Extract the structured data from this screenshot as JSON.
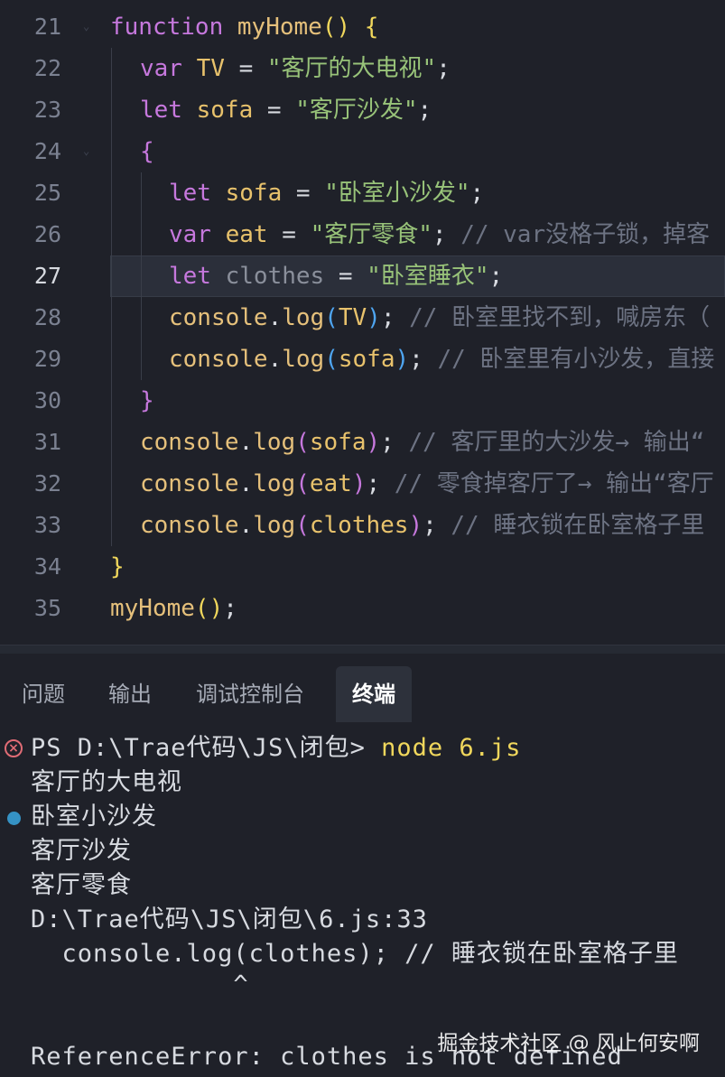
{
  "editor": {
    "lines": [
      {
        "num": "21",
        "tokens": [
          [
            "kw",
            "function"
          ],
          [
            "punc",
            " "
          ],
          [
            "fn",
            "myHome"
          ],
          [
            "ph",
            "()"
          ],
          [
            "punc",
            " "
          ],
          [
            "ph",
            "{"
          ]
        ]
      },
      {
        "num": "22",
        "tokens": [
          [
            "kw",
            "var"
          ],
          [
            "punc",
            " "
          ],
          [
            "var",
            "TV"
          ],
          [
            "punc",
            " = "
          ],
          [
            "str",
            "\"客厅的大电视\""
          ],
          [
            "punc",
            ";"
          ]
        ]
      },
      {
        "num": "23",
        "tokens": [
          [
            "kw",
            "let"
          ],
          [
            "punc",
            " "
          ],
          [
            "var",
            "sofa"
          ],
          [
            "punc",
            " = "
          ],
          [
            "str",
            "\"客厅沙发\""
          ],
          [
            "punc",
            ";"
          ]
        ]
      },
      {
        "num": "24",
        "tokens": [
          [
            "pp",
            "{"
          ]
        ]
      },
      {
        "num": "25",
        "tokens": [
          [
            "kw",
            "let"
          ],
          [
            "punc",
            " "
          ],
          [
            "var",
            "sofa"
          ],
          [
            "punc",
            " = "
          ],
          [
            "str",
            "\"卧室小沙发\""
          ],
          [
            "punc",
            ";"
          ]
        ]
      },
      {
        "num": "26",
        "tokens": [
          [
            "kw",
            "var"
          ],
          [
            "punc",
            " "
          ],
          [
            "var",
            "eat"
          ],
          [
            "punc",
            " = "
          ],
          [
            "str",
            "\"客厅零食\""
          ],
          [
            "punc",
            "; "
          ],
          [
            "cmt",
            "// var没格子锁，掉客"
          ]
        ]
      },
      {
        "num": "27",
        "tokens": [
          [
            "kw",
            "let"
          ],
          [
            "punc",
            " "
          ],
          [
            "grey",
            "clothes"
          ],
          [
            "punc",
            " = "
          ],
          [
            "str",
            "\"卧室睡衣\""
          ],
          [
            "punc",
            ";"
          ]
        ]
      },
      {
        "num": "28",
        "tokens": [
          [
            "fnn",
            "console"
          ],
          [
            "punc",
            "."
          ],
          [
            "fnn",
            "log"
          ],
          [
            "pb",
            "("
          ],
          [
            "var",
            "TV"
          ],
          [
            "pb",
            ")"
          ],
          [
            "punc",
            "; "
          ],
          [
            "cmt",
            "// 卧室里找不到，喊房东（"
          ]
        ]
      },
      {
        "num": "29",
        "tokens": [
          [
            "fnn",
            "console"
          ],
          [
            "punc",
            "."
          ],
          [
            "fnn",
            "log"
          ],
          [
            "pb",
            "("
          ],
          [
            "var",
            "sofa"
          ],
          [
            "pb",
            ")"
          ],
          [
            "punc",
            "; "
          ],
          [
            "cmt",
            "// 卧室里有小沙发，直接"
          ]
        ]
      },
      {
        "num": "30",
        "tokens": [
          [
            "pp",
            "}"
          ]
        ]
      },
      {
        "num": "31",
        "tokens": [
          [
            "fnn",
            "console"
          ],
          [
            "punc",
            "."
          ],
          [
            "fnn",
            "log"
          ],
          [
            "pp",
            "("
          ],
          [
            "var",
            "sofa"
          ],
          [
            "pp",
            ")"
          ],
          [
            "punc",
            "; "
          ],
          [
            "cmt",
            "// 客厅里的大沙发→ 输出“"
          ]
        ]
      },
      {
        "num": "32",
        "tokens": [
          [
            "fnn",
            "console"
          ],
          [
            "punc",
            "."
          ],
          [
            "fnn",
            "log"
          ],
          [
            "pp",
            "("
          ],
          [
            "var",
            "eat"
          ],
          [
            "pp",
            ")"
          ],
          [
            "punc",
            "; "
          ],
          [
            "cmt",
            "// 零食掉客厅了→ 输出“客厅"
          ]
        ]
      },
      {
        "num": "33",
        "tokens": [
          [
            "fnn",
            "console"
          ],
          [
            "punc",
            "."
          ],
          [
            "fnn",
            "log"
          ],
          [
            "pp",
            "("
          ],
          [
            "var",
            "clothes"
          ],
          [
            "pp",
            ")"
          ],
          [
            "punc",
            "; "
          ],
          [
            "cmt",
            "// 睡衣锁在卧室格子里"
          ]
        ]
      },
      {
        "num": "34",
        "tokens": [
          [
            "ph",
            "}"
          ]
        ]
      },
      {
        "num": "35",
        "tokens": [
          [
            "fn",
            "myHome"
          ],
          [
            "ph",
            "()"
          ],
          [
            "punc",
            ";"
          ]
        ]
      }
    ]
  },
  "panel": {
    "tabs": [
      "问题",
      "输出",
      "调试控制台",
      "终端"
    ],
    "active_tab": "终端"
  },
  "terminal": {
    "prompt": "PS D:\\Trae代码\\JS\\闭包> ",
    "command": "node 6.js",
    "out1": "客厅的大电视",
    "out2": "卧室小沙发",
    "out3": "客厅沙发",
    "out4": "客厅零食",
    "trace_path": "D:\\Trae代码\\JS\\闭包\\6.js:33",
    "trace_code": "  console.log(clothes); // 睡衣锁在卧室格子里",
    "trace_caret": "             ^",
    "error": "ReferenceError: clothes is not defined"
  },
  "watermark": "掘金技术社区 @ 风止何安啊",
  "colors": {
    "background": "#1f2129",
    "keyword": "#c678dd",
    "string": "#98c379",
    "comment": "#6d7383",
    "function": "#e5c07b",
    "error": "#e06c75",
    "breakpoint_dot": "#3592c4"
  },
  "icons": [
    "fold-chevron-icon",
    "error-circle-icon",
    "dot-marker-icon"
  ]
}
